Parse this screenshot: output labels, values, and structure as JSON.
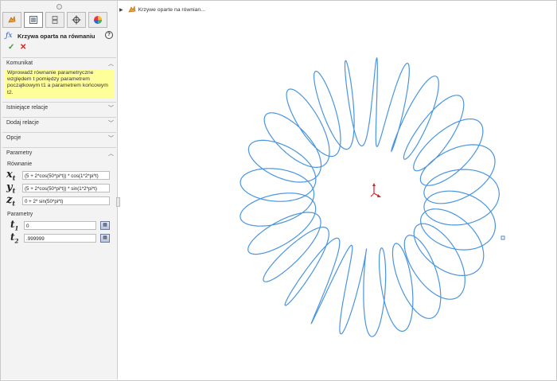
{
  "tabs": [
    {
      "name": "feature-manager-tab",
      "icon": "feature-tree-icon"
    },
    {
      "name": "property-manager-tab",
      "icon": "property-manager-icon"
    },
    {
      "name": "configuration-manager-tab",
      "icon": "configuration-icon"
    },
    {
      "name": "dimxpert-tab",
      "icon": "crosshair-icon"
    },
    {
      "name": "display-manager-tab",
      "icon": "color-wheel-icon"
    }
  ],
  "header": {
    "title": "Krzywa oparta na równaniu",
    "icon": "equation-curve-icon",
    "help": "?"
  },
  "actions": {
    "ok": "✓",
    "cancel": "✕"
  },
  "message": {
    "title": "Komunikat",
    "text": "Wprowadź równanie parametryczne względem t pomiędzy parametrem początkowym t1 a parametrem końcowym t2."
  },
  "sections": {
    "existing": "Istniejące relacje",
    "add": "Dodaj relacje",
    "options": "Opcje",
    "parameters": "Parametry"
  },
  "equations": {
    "label": "Równanie",
    "x": {
      "sym": "x",
      "sub": "t",
      "value": "(5 + 2*cos(50*pi*t)) * cos(1*2*pi*t)"
    },
    "y": {
      "sym": "y",
      "sub": "t",
      "value": "(5 + 2*cos(50*pi*t)) * sin(1*2*pi*t)"
    },
    "z": {
      "sym": "z",
      "sub": "t",
      "value": "0 + 2* sin(50*pi*t)"
    }
  },
  "params": {
    "label": "Parametry",
    "t1": {
      "sym": "t",
      "sub": "1",
      "value": "0"
    },
    "t2": {
      "sym": "t",
      "sub": "2",
      "value": ".999999"
    }
  },
  "tree": {
    "label": "Krzywe oparte na równian..."
  },
  "colors": {
    "curve": "#4a95e0",
    "highlight": "#ffff9a",
    "ok": "#3a9b2f",
    "cancel": "#dd2222",
    "axis": "#e02020"
  }
}
